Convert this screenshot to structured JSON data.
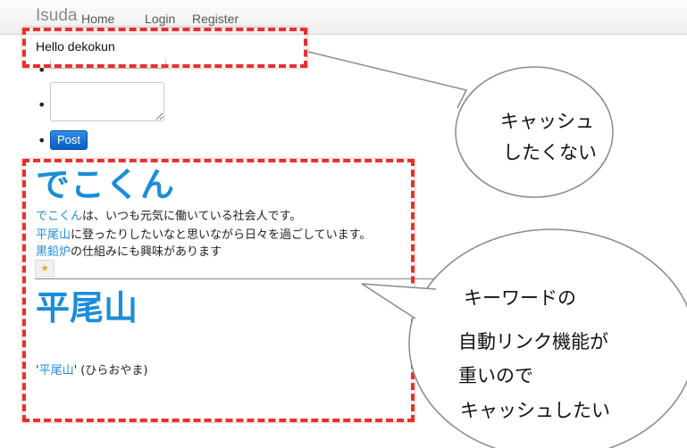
{
  "nav": {
    "brand": "Isuda",
    "links": [
      "Home",
      "Login",
      "Register"
    ]
  },
  "greeting": "Hello dekokun",
  "form": {
    "post_button": "Post"
  },
  "entry1": {
    "title": "でこくん",
    "line1_kw": "でこくん",
    "line1_rest": "は、いつも元気に働いている社会人です。",
    "line2_kw": "平尾山",
    "line2_rest": "に登ったりしたいなと思いながら日々を過ごしています。",
    "line3_kw": "黒鉛炉",
    "line3_rest": "の仕組みにも興味があります",
    "star": "★"
  },
  "entry2": {
    "title": "平尾山",
    "reading_open": "'",
    "reading_kw": "平尾山",
    "reading_rest": "' (ひらおやま)"
  },
  "annotations": {
    "callout1_line1": "キャッシュ",
    "callout1_line2": "したくない",
    "callout2_line1": "キーワードの",
    "callout2_line2": "自動リンク機能が",
    "callout2_line3": "重いので",
    "callout2_line4": "キャッシュしたい"
  },
  "colors": {
    "link_blue": "#1a8ed8",
    "annotation_red": "#e5322b",
    "post_button": "#0a5dc2"
  }
}
